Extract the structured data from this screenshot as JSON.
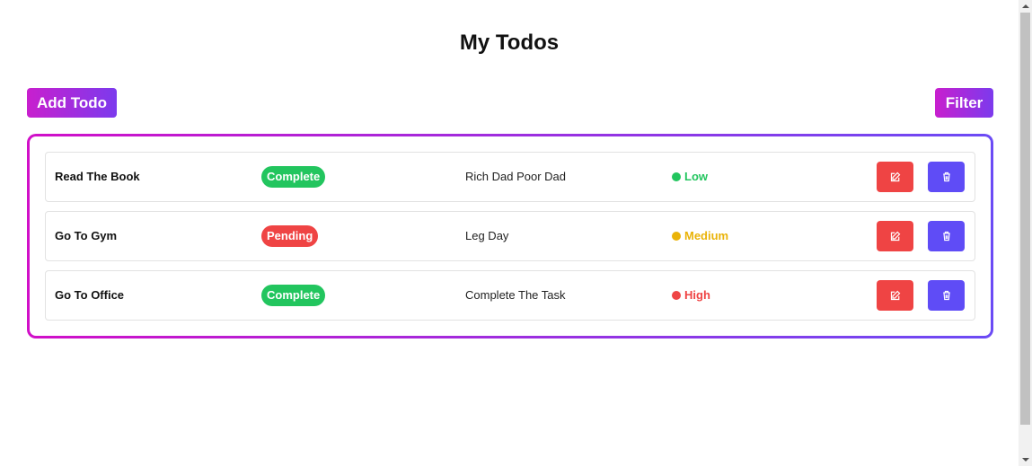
{
  "header": {
    "title": "My Todos"
  },
  "toolbar": {
    "add_label": "Add Todo",
    "filter_label": "Filter"
  },
  "colors": {
    "gradient_start": "#c81fce",
    "gradient_end": "#7c3aed",
    "complete": "#22c55e",
    "pending": "#ef4444",
    "low": "#22c55e",
    "medium": "#eab308",
    "high": "#ef4444",
    "edit_button": "#ef4444",
    "delete_button": "#5f4cf6"
  },
  "todos": [
    {
      "name": "Read The Book",
      "status": "Complete",
      "description": "Rich Dad Poor Dad",
      "priority": "Low"
    },
    {
      "name": "Go To Gym",
      "status": "Pending",
      "description": "Leg Day",
      "priority": "Medium"
    },
    {
      "name": "Go To Office",
      "status": "Complete",
      "description": "Complete The Task",
      "priority": "High"
    }
  ],
  "icons": {
    "edit": "pencil-square-icon",
    "delete": "trash-icon"
  }
}
